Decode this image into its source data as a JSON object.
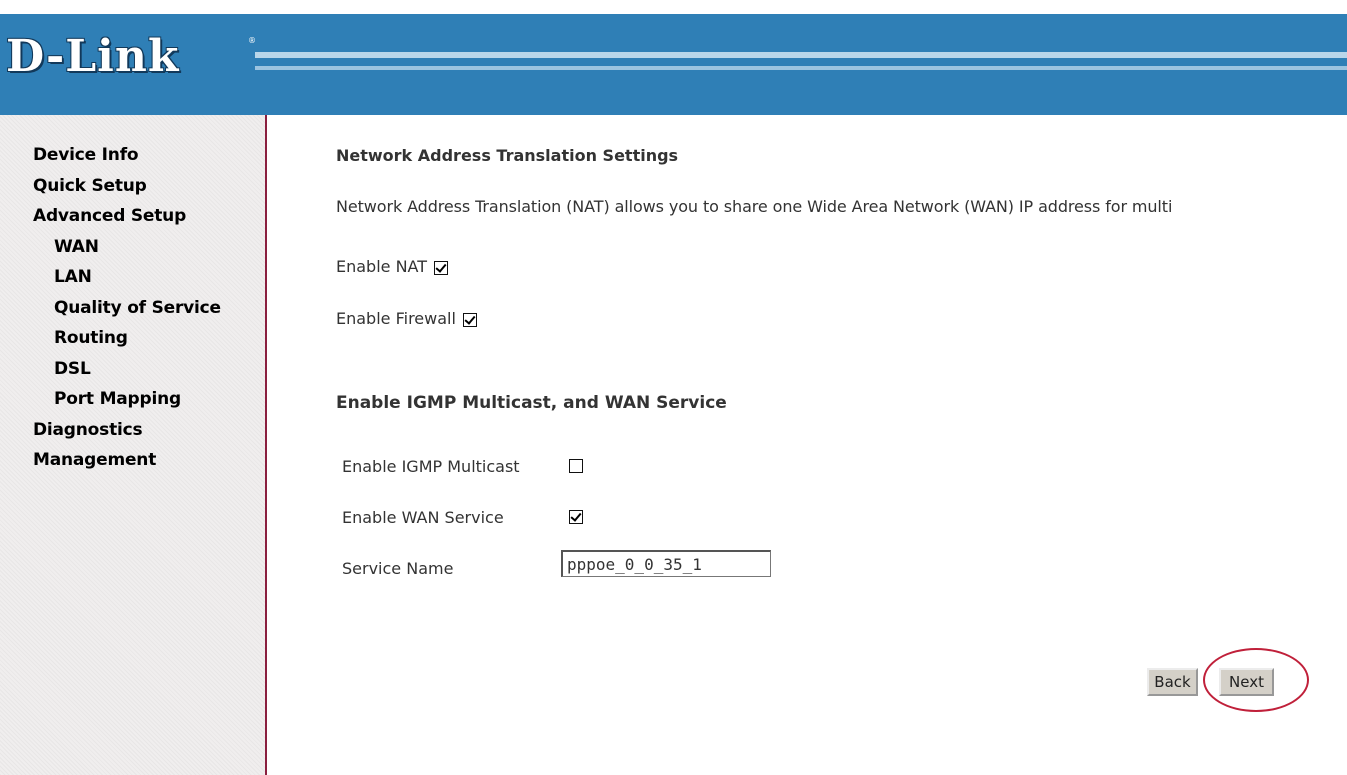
{
  "header": {
    "logo_text": "D-Link",
    "logo_mark": "®",
    "brand_color": "#2f7fb6"
  },
  "sidebar": {
    "items": [
      {
        "label": "Device Info"
      },
      {
        "label": "Quick Setup"
      },
      {
        "label": "Advanced Setup"
      },
      {
        "label": "WAN"
      },
      {
        "label": "LAN"
      },
      {
        "label": "Quality of Service"
      },
      {
        "label": "Routing"
      },
      {
        "label": "DSL"
      },
      {
        "label": "Port Mapping"
      },
      {
        "label": "Diagnostics"
      },
      {
        "label": "Management"
      }
    ]
  },
  "main": {
    "title": "Network Address Translation Settings",
    "description": "Network Address Translation (NAT) allows you to share one Wide Area Network (WAN) IP address for multi",
    "enable_nat_label": "Enable NAT",
    "enable_nat_checked": true,
    "enable_firewall_label": "Enable Firewall",
    "enable_firewall_checked": true,
    "section2_title": "Enable IGMP Multicast, and WAN Service",
    "igmp_label": "Enable IGMP Multicast",
    "igmp_checked": false,
    "wan_service_label": "Enable WAN Service",
    "wan_service_checked": true,
    "service_name_label": "Service Name",
    "service_name_value": "pppoe_0_0_35_1"
  },
  "buttons": {
    "back_label": "Back",
    "next_label": "Next"
  },
  "colors": {
    "highlight_circle": "#c0203a",
    "sidebar_border": "#8a1f3f"
  }
}
